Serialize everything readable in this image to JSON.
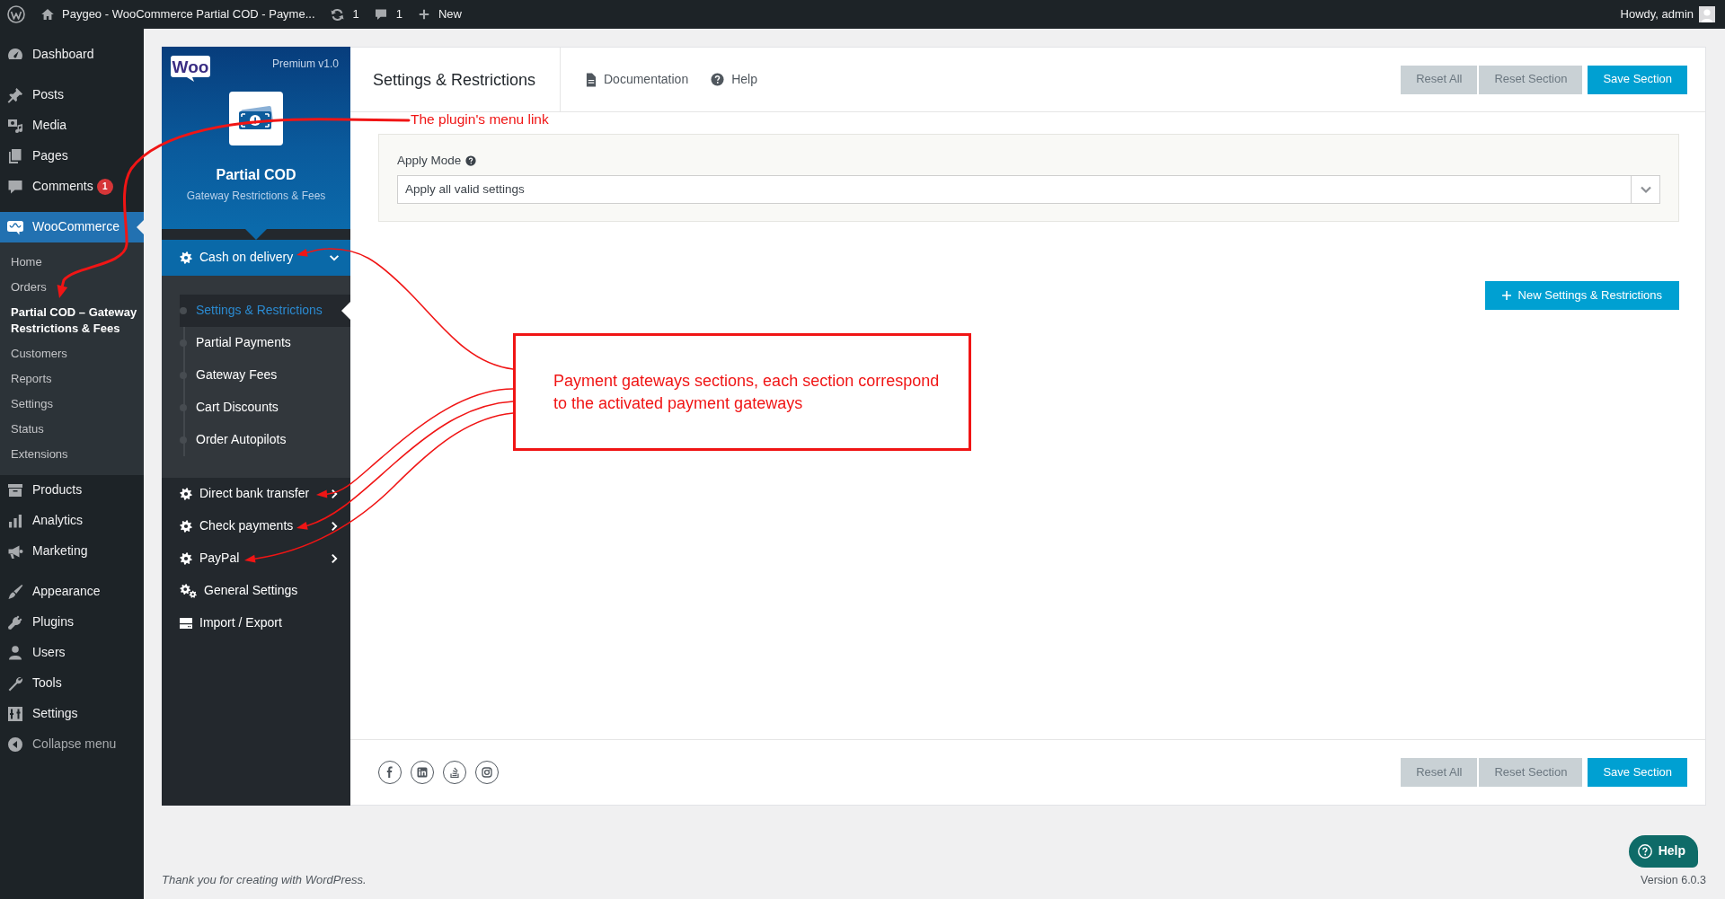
{
  "admin_bar": {
    "site_title": "Paygeo - WooCommerce Partial COD - Payme...",
    "updates_count": "1",
    "comments_count": "1",
    "new_label": "New",
    "greeting": "Howdy, admin"
  },
  "admin_menu": {
    "sections": [
      {
        "items": [
          {
            "label": "Dashboard",
            "selected": false
          }
        ]
      },
      {
        "items": [
          {
            "label": "Posts",
            "selected": false
          },
          {
            "label": "Media",
            "selected": false
          },
          {
            "label": "Pages",
            "selected": false
          },
          {
            "label": "Comments",
            "selected": false,
            "badge": "1"
          }
        ]
      },
      {
        "items": [
          {
            "label": "WooCommerce",
            "selected": true,
            "children": [
              {
                "label": "Home",
                "selected": false
              },
              {
                "label": "Orders",
                "selected": false
              },
              {
                "label": "Partial COD – Gateway Restrictions & Fees",
                "selected": true
              },
              {
                "label": "Customers",
                "selected": false
              },
              {
                "label": "Reports",
                "selected": false
              },
              {
                "label": "Settings",
                "selected": false
              },
              {
                "label": "Status",
                "selected": false
              },
              {
                "label": "Extensions",
                "selected": false
              }
            ]
          },
          {
            "label": "Products",
            "selected": false
          },
          {
            "label": "Analytics",
            "selected": false
          },
          {
            "label": "Marketing",
            "selected": false
          }
        ]
      },
      {
        "items": [
          {
            "label": "Appearance",
            "selected": false
          },
          {
            "label": "Plugins",
            "selected": false
          },
          {
            "label": "Users",
            "selected": false
          },
          {
            "label": "Tools",
            "selected": false
          },
          {
            "label": "Settings",
            "selected": false
          }
        ]
      }
    ],
    "collapse_label": "Collapse menu"
  },
  "plugin_sidebar": {
    "logo_text": "Woo",
    "edition": "Premium v1.0",
    "title": "Partial COD",
    "subtitle": "Gateway Restrictions & Fees",
    "gateway_sections": [
      {
        "label": "Cash on delivery",
        "expanded": true,
        "children": [
          {
            "label": "Settings & Restrictions",
            "selected": true
          },
          {
            "label": "Partial Payments",
            "selected": false
          },
          {
            "label": "Gateway Fees",
            "selected": false
          },
          {
            "label": "Cart Discounts",
            "selected": false
          },
          {
            "label": "Order Autopilots",
            "selected": false
          }
        ]
      },
      {
        "label": "Direct bank transfer",
        "expanded": false
      },
      {
        "label": "Check payments",
        "expanded": false
      },
      {
        "label": "PayPal",
        "expanded": false
      }
    ],
    "other_links": [
      {
        "label": "General Settings"
      },
      {
        "label": "Import / Export"
      }
    ]
  },
  "main": {
    "title": "Settings & Restrictions",
    "header_links": [
      {
        "label": "Documentation"
      },
      {
        "label": "Help"
      }
    ],
    "header_buttons": [
      {
        "label": "Reset All",
        "kind": "secondary"
      },
      {
        "label": "Reset Section",
        "kind": "secondary"
      },
      {
        "label": "Save Section",
        "kind": "primary"
      }
    ],
    "apply_mode": {
      "label": "Apply Mode",
      "value": "Apply all valid settings"
    },
    "new_button": "New Settings & Restrictions",
    "footer_buttons": [
      {
        "label": "Reset All",
        "kind": "secondary"
      },
      {
        "label": "Reset Section",
        "kind": "secondary"
      },
      {
        "label": "Save Section",
        "kind": "primary"
      }
    ]
  },
  "help_button": "Help",
  "wp_footer": {
    "text": "Thank you for creating with ",
    "link": "WordPress",
    "text_after": ".",
    "version": "Version 6.0.3"
  },
  "annotations": {
    "menu_link_label": "The plugin's menu link",
    "sections_callout": "Payment gateways sections, each section correspond to the activated payment gateways"
  }
}
